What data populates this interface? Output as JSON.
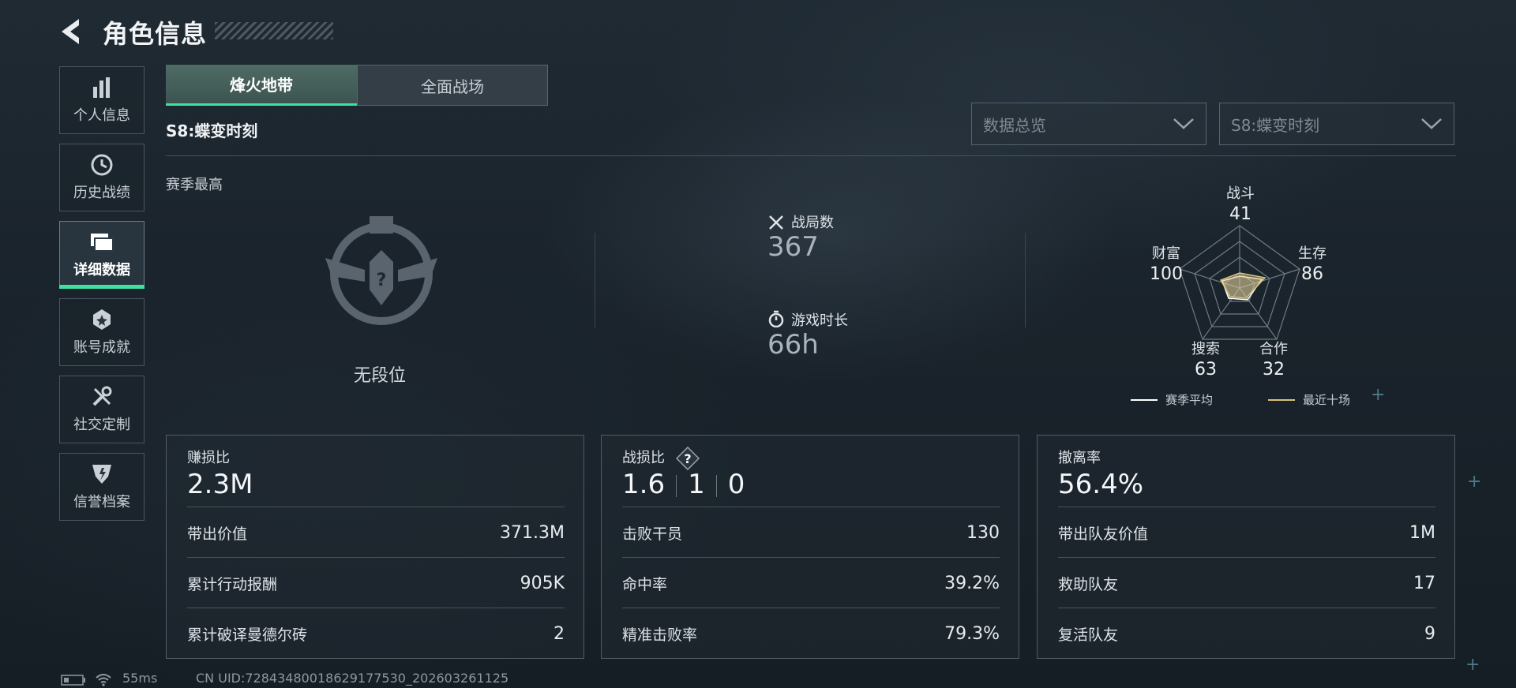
{
  "header": {
    "title": "角色信息"
  },
  "sidebar": {
    "items": [
      {
        "label": "个人信息",
        "icon": "bar-chart-icon"
      },
      {
        "label": "历史战绩",
        "icon": "clock-icon"
      },
      {
        "label": "详细数据",
        "icon": "folder-icon",
        "active": true
      },
      {
        "label": "账号成就",
        "icon": "medal-icon"
      },
      {
        "label": "社交定制",
        "icon": "wrench-icon"
      },
      {
        "label": "信誉档案",
        "icon": "shield-icon"
      }
    ]
  },
  "tabs": [
    {
      "label": "烽火地带",
      "active": true
    },
    {
      "label": "全面战场",
      "active": false
    }
  ],
  "season_title": "S8:蝶变时刻",
  "filters": {
    "category": "数据总览",
    "season": "S8:蝶变时刻"
  },
  "best": {
    "label": "赛季最高",
    "rank": "无段位"
  },
  "stats": {
    "matches_label": "战局数",
    "matches_value": "367",
    "playtime_label": "游戏时长",
    "playtime_value": "66h"
  },
  "radar": {
    "axes": [
      {
        "label": "战斗",
        "value": "41"
      },
      {
        "label": "生存",
        "value": "86"
      },
      {
        "label": "合作",
        "value": "32"
      },
      {
        "label": "搜索",
        "value": "63"
      },
      {
        "label": "财富",
        "value": "100"
      }
    ],
    "legend_season": "赛季平均",
    "legend_recent": "最近十场",
    "colors": {
      "season": "#ffffff",
      "recent": "#d8c27a"
    }
  },
  "cards": [
    {
      "title": "赚损比",
      "big": "2.3M",
      "rows": [
        {
          "k": "带出价值",
          "v": "371.3M"
        },
        {
          "k": "累计行动报酬",
          "v": "905K"
        },
        {
          "k": "累计破译曼德尔砖",
          "v": "2"
        }
      ]
    },
    {
      "title": "战损比",
      "big_parts": [
        "1.6",
        "1",
        "0"
      ],
      "rows": [
        {
          "k": "击败干员",
          "v": "130"
        },
        {
          "k": "命中率",
          "v": "39.2%"
        },
        {
          "k": "精准击败率",
          "v": "79.3%"
        }
      ]
    },
    {
      "title": "撤离率",
      "big": "56.4%",
      "rows": [
        {
          "k": "带出队友价值",
          "v": "1M"
        },
        {
          "k": "救助队友",
          "v": "17"
        },
        {
          "k": "复活队友",
          "v": "9"
        }
      ]
    }
  ],
  "status": {
    "ping": "55ms",
    "uid": "CN UID:72843480018629177530_202603261125"
  },
  "accent": "#3ee2a0"
}
